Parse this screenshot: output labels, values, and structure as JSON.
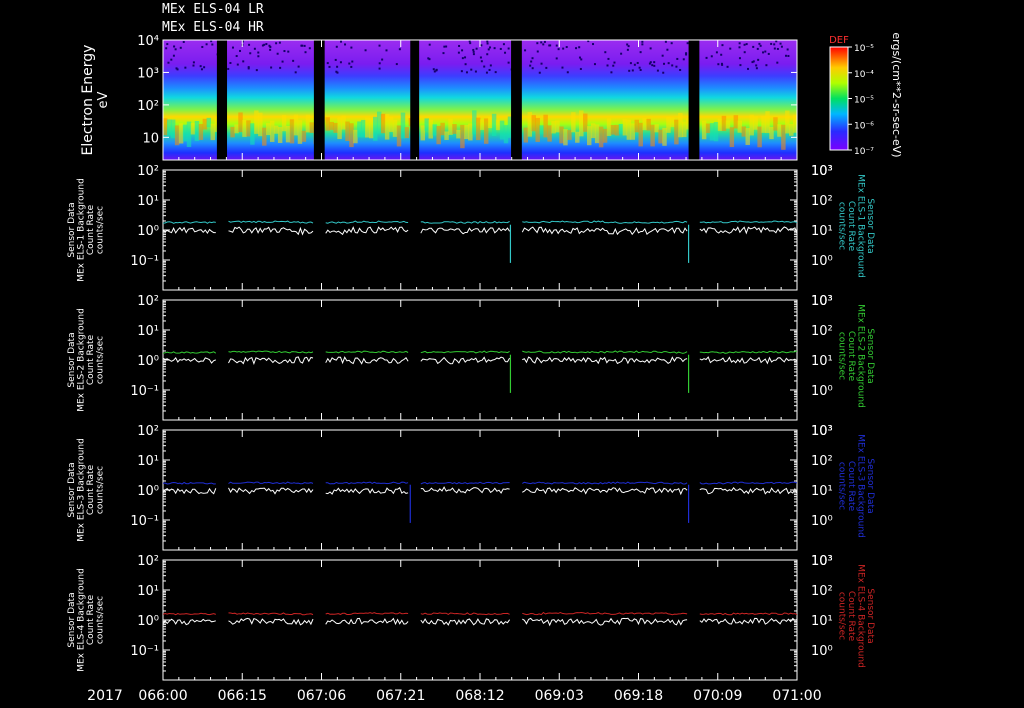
{
  "header": {
    "title_lr": "MEx ELS-04 LR",
    "title_hr": "MEx ELS-04 HR"
  },
  "colors": {
    "background": "#000000",
    "frame": "#ffffff",
    "data_gap": "#000000",
    "series_cyan": "#33c7c7",
    "series_green": "#33cc33",
    "series_blue": "#1f2ed6",
    "series_red": "#cc2424",
    "series_white": "#ffffff"
  },
  "chart_data": [
    {
      "type": "heatmap",
      "ylabel": "Electron Energy",
      "yunit": "eV",
      "yscale": "log",
      "ylim": [
        2,
        10000
      ],
      "yticks": [
        "10",
        "10²",
        "10³",
        "10⁴"
      ],
      "ytick_values": [
        10,
        100,
        1000,
        10000
      ],
      "colorbar": {
        "label": "DEF",
        "unit": "ergs/(cm**2-sr-sec-eV)",
        "scale": "log",
        "range": [
          1e-07,
          1e-05
        ],
        "ticks": [
          "10⁻⁵",
          "10⁻⁴",
          "10⁻⁵",
          "10⁻⁶",
          "10⁻⁷"
        ]
      },
      "data_gaps_fraction": [
        [
          0.085,
          0.101
        ],
        [
          0.238,
          0.255
        ],
        [
          0.39,
          0.404
        ],
        [
          0.549,
          0.566
        ],
        [
          0.829,
          0.846
        ]
      ],
      "intensity_profile": [
        {
          "energy": 3,
          "level": 0.35
        },
        {
          "energy": 6,
          "level": 0.55
        },
        {
          "energy": 15,
          "level": 0.85
        },
        {
          "energy": 30,
          "level": 0.75
        },
        {
          "energy": 80,
          "level": 0.55
        },
        {
          "energy": 300,
          "level": 0.35
        },
        {
          "energy": 2000,
          "level": 0.2
        }
      ]
    },
    {
      "type": "line",
      "ylabel": "Sensor Data MEx ELS-1 Background Count Rate counts/sec",
      "right_label": "Sensor Data MEx ELS-1 Background Count Rate counts/sec",
      "yscale": "log",
      "ylim": [
        0.01,
        100
      ],
      "right_ylim": [
        0.1,
        1000
      ],
      "yticks": [
        "10⁻¹",
        "10⁰",
        "10¹",
        "10²"
      ],
      "right_yticks": [
        "10⁰",
        "10¹",
        "10²",
        "10³"
      ],
      "series": [
        {
          "color": "series_cyan",
          "values": [
            1.8,
            1.9,
            1.8,
            1.9,
            1.8,
            1.85,
            1.9,
            1.8,
            1.85,
            1.9,
            1.8
          ],
          "spikes": [
            0.548,
            0.829
          ]
        },
        {
          "color": "series_white",
          "values": [
            1.0,
            1.05,
            0.95,
            1.05,
            1.0,
            1.05,
            1.0,
            0.95,
            1.0,
            1.05,
            1.0
          ]
        }
      ]
    },
    {
      "type": "line",
      "ylabel": "Sensor Data MEx ELS-2 Background Count Rate counts/sec",
      "right_label": "Sensor Data MEx ELS-2 Background Count Rate counts/sec",
      "yscale": "log",
      "ylim": [
        0.01,
        100
      ],
      "right_ylim": [
        0.1,
        1000
      ],
      "yticks": [
        "10⁻¹",
        "10⁰",
        "10¹",
        "10²"
      ],
      "right_yticks": [
        "10⁰",
        "10¹",
        "10²",
        "10³"
      ],
      "series": [
        {
          "color": "series_green",
          "values": [
            1.8,
            1.9,
            1.85,
            1.9,
            1.85,
            1.9,
            1.85,
            1.9,
            1.8,
            1.85,
            1.9
          ],
          "spikes": [
            0.548,
            0.829
          ]
        },
        {
          "color": "series_white",
          "values": [
            1.0,
            1.0,
            1.05,
            1.0,
            1.0,
            1.05,
            1.0,
            1.0,
            1.05,
            1.0,
            1.0
          ]
        }
      ]
    },
    {
      "type": "line",
      "ylabel": "Sensor Data MEx ELS-3 Background Count Rate counts/sec",
      "right_label": "Sensor Data MEx ELS-3 Background Count Rate counts/sec",
      "yscale": "log",
      "ylim": [
        0.01,
        100
      ],
      "right_ylim": [
        0.1,
        1000
      ],
      "yticks": [
        "10⁻¹",
        "10⁰",
        "10¹",
        "10²"
      ],
      "right_yticks": [
        "10⁰",
        "10¹",
        "10²",
        "10³"
      ],
      "series": [
        {
          "color": "series_blue",
          "values": [
            1.7,
            1.75,
            1.7,
            1.75,
            1.7,
            1.75,
            1.7,
            1.75,
            1.7,
            1.75,
            1.7
          ],
          "spikes": [
            0.39,
            0.829
          ]
        },
        {
          "color": "series_white",
          "values": [
            1.0,
            1.0,
            0.95,
            1.0,
            1.05,
            1.0,
            1.0,
            1.0,
            0.95,
            1.0,
            1.0
          ]
        }
      ]
    },
    {
      "type": "line",
      "ylabel": "Sensor Data MEx ELS-4 Background Count Rate counts/sec",
      "right_label": "Sensor Data MEx ELS-4 Background Count Rate counts/sec",
      "yscale": "log",
      "ylim": [
        0.01,
        100
      ],
      "right_ylim": [
        0.1,
        1000
      ],
      "yticks": [
        "10⁻¹",
        "10⁰",
        "10¹",
        "10²"
      ],
      "right_yticks": [
        "10⁰",
        "10¹",
        "10²",
        "10³"
      ],
      "series": [
        {
          "color": "series_red",
          "values": [
            1.6,
            1.65,
            1.6,
            1.7,
            1.65,
            1.6,
            1.7,
            1.65,
            1.6,
            1.65,
            1.6
          ],
          "spikes": []
        },
        {
          "color": "series_white",
          "values": [
            0.9,
            0.95,
            0.9,
            0.95,
            0.9,
            0.95,
            0.9,
            0.95,
            0.9,
            0.95,
            0.9
          ]
        }
      ]
    }
  ],
  "time_axis": {
    "year": "2017",
    "tick_labels": [
      "066:00",
      "066:15",
      "067:06",
      "067:21",
      "068:12",
      "069:03",
      "069:18",
      "070:09",
      "071:00"
    ],
    "minor_ticks_per_major": 4
  }
}
